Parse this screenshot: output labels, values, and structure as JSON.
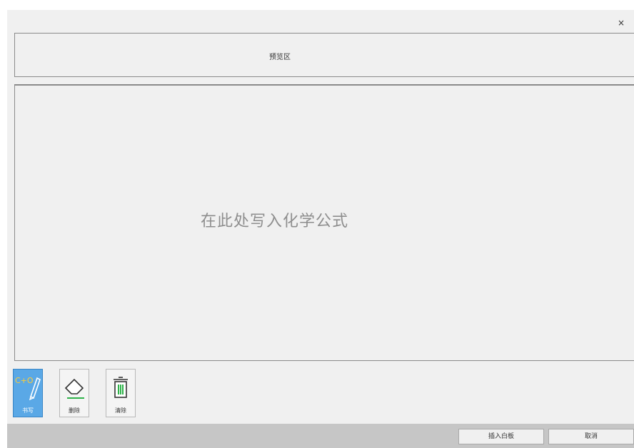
{
  "window": {
    "close_symbol": "×"
  },
  "preview": {
    "label": "预览区"
  },
  "canvas": {
    "hint": "在此处写入化学公式"
  },
  "tools": [
    {
      "name": "write",
      "label": "书写",
      "icon_text": "C+O",
      "icon": "pen-formula-icon",
      "active": true
    },
    {
      "name": "delete",
      "label": "删除",
      "icon": "eraser-icon",
      "active": false
    },
    {
      "name": "clear",
      "label": "清除",
      "icon": "trash-icon",
      "active": false
    }
  ],
  "buttons": {
    "insert": "插入白板",
    "cancel": "取消"
  },
  "colors": {
    "active_tool": "#5aa8e6",
    "eraser_line": "#2fb34a",
    "trash_lines": "#2fb34a",
    "hint_text": "#8e8e8e"
  }
}
